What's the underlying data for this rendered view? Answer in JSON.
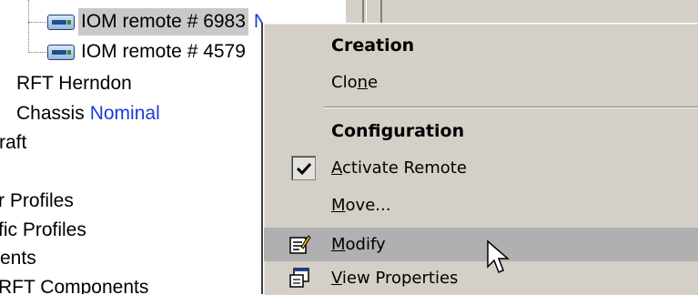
{
  "tree": {
    "rows": [
      {
        "label": "IOM remote # 6983",
        "status": "Nominal"
      },
      {
        "label": "IOM remote # 4579"
      },
      {
        "label": "RFT Herndon"
      },
      {
        "label": "Chassis",
        "status": "Nominal"
      },
      {
        "label": "raft"
      },
      {
        "label": "r Profiles"
      },
      {
        "label": "fic Profiles"
      },
      {
        "label": "ents"
      },
      {
        "label": "RFT Components"
      }
    ]
  },
  "menu": {
    "creation_header": "Creation",
    "clone": {
      "before": "Clo",
      "accel": "n",
      "after": "e"
    },
    "configuration_header": "Configuration",
    "activate_remote": {
      "accel": "A",
      "after": "ctivate Remote",
      "checked": true
    },
    "move": {
      "accel": "M",
      "after": "ove..."
    },
    "modify": {
      "accel": "M",
      "after": "odify"
    },
    "view_properties": {
      "accel": "V",
      "after": "iew Properties"
    }
  },
  "colors": {
    "status_blue": "#1a3cd8",
    "menu_bg": "#d4d0c8",
    "highlight": "#b0b0b0"
  },
  "icons": {
    "device": "remote-device-icon",
    "check": "check-icon",
    "modify": "modify-icon",
    "view_properties": "view-properties-icon",
    "pointer": "mouse-pointer-icon"
  }
}
